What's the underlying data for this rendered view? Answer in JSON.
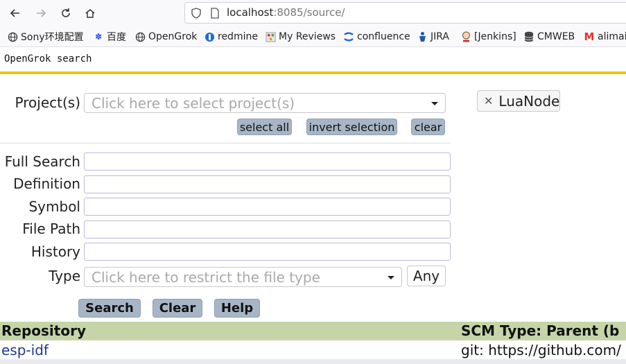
{
  "browser": {
    "url_host": "localhost",
    "url_rest": ":8085/source/"
  },
  "bookmarks": [
    {
      "label": "Sony环境配置",
      "icon": "globe-icon"
    },
    {
      "label": "百度",
      "icon": "baidu-paw-icon"
    },
    {
      "label": "OpenGrok",
      "icon": "globe-icon"
    },
    {
      "label": "redmine",
      "icon": "redmine-icon"
    },
    {
      "label": "My Reviews",
      "icon": "reviews-icon"
    },
    {
      "label": "confluence",
      "icon": "confluence-icon"
    },
    {
      "label": "JIRA",
      "icon": "jira-icon"
    },
    {
      "label": "[Jenkins]",
      "icon": "jenkins-icon"
    },
    {
      "label": "CMWEB",
      "icon": "database-icon"
    },
    {
      "label": "alimail",
      "icon": "alimail-icon"
    }
  ],
  "header": {
    "title": "OpenGrok search"
  },
  "form": {
    "projects_label": "Project(s)",
    "projects_placeholder": "Click here to select project(s)",
    "select_all": "select all",
    "invert_selection": "invert selection",
    "clear_small": "clear",
    "selected_project": "LuaNode",
    "full_search_label": "Full Search",
    "definition_label": "Definition",
    "symbol_label": "Symbol",
    "file_path_label": "File Path",
    "history_label": "History",
    "type_label": "Type",
    "type_placeholder": "Click here to restrict the file type",
    "type_any": "Any",
    "search_button": "Search",
    "clear_button": "Clear",
    "help_button": "Help"
  },
  "table": {
    "headers": [
      "Repository",
      "SCM Type: Parent (b"
    ],
    "rows": [
      {
        "repository": "esp-idf",
        "scm": "git: https://github.com/"
      }
    ]
  },
  "colors": {
    "accent_rule": "#f2c419",
    "button_bg": "#a7b6c7",
    "table_header_bg": "#c5d5a8",
    "link": "#1f3a93"
  }
}
